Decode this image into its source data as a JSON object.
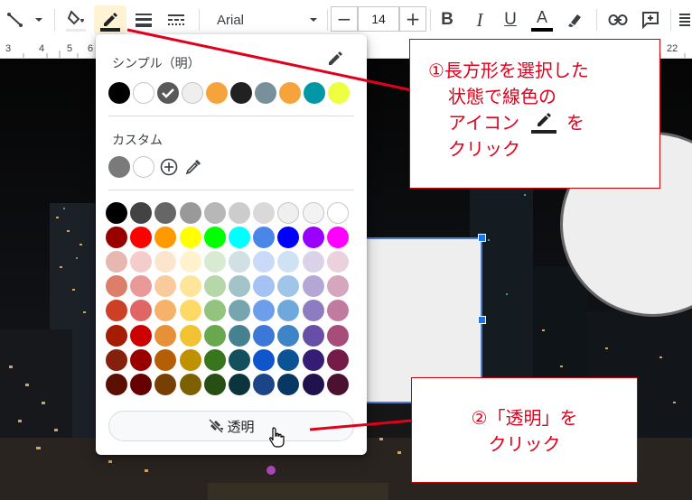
{
  "toolbar": {
    "font_name": "Arial",
    "font_size": "14",
    "minus": "−",
    "plus": "+",
    "bold": "B",
    "italic": "I",
    "underline": "U",
    "text_color": "A",
    "text_color_bar": "#000000",
    "fill_color_bar": "#e8eaed",
    "border_color_bar": "#202124",
    "highlight_color": "#fff3d6"
  },
  "ruler": {
    "marks": [
      "3",
      "4",
      "5",
      "6",
      "22"
    ]
  },
  "palette": {
    "simple_label": "シンプル（明）",
    "custom_label": "カスタム",
    "simple_colors": [
      "#000000",
      "#ffffff",
      "#595959",
      "#eeeeee",
      "#f6a33b",
      "#212121",
      "#78909c",
      "#f6a33b",
      "#0097a7",
      "#eeff41"
    ],
    "selected_index": 2,
    "custom_colors": [
      "#7a7a7a",
      "#ffffff"
    ],
    "grid": [
      [
        "#000000",
        "#434343",
        "#666666",
        "#999999",
        "#b7b7b7",
        "#cccccc",
        "#d9d9d9",
        "#efefef",
        "#f3f3f3",
        "#ffffff"
      ],
      [
        "#980000",
        "#ff0000",
        "#ff9900",
        "#ffff00",
        "#00ff00",
        "#00ffff",
        "#4a86e8",
        "#0000ff",
        "#9900ff",
        "#ff00ff"
      ],
      [
        "#e6b8af",
        "#f4cccc",
        "#fce5cd",
        "#fff2cc",
        "#d9ead3",
        "#d0e0e3",
        "#c9daf8",
        "#cfe2f3",
        "#d9d2e9",
        "#ead1dc"
      ],
      [
        "#dd7e6b",
        "#ea9999",
        "#f9cb9c",
        "#ffe599",
        "#b6d7a8",
        "#a2c4c9",
        "#a4c2f4",
        "#9fc5e8",
        "#b4a7d6",
        "#d5a6bd"
      ],
      [
        "#cc4125",
        "#e06666",
        "#f6b26b",
        "#ffd966",
        "#93c47d",
        "#76a5af",
        "#6d9eeb",
        "#6fa8dc",
        "#8e7cc3",
        "#c27ba0"
      ],
      [
        "#a61c00",
        "#cc0000",
        "#e69138",
        "#f1c232",
        "#6aa84f",
        "#45818e",
        "#3c78d8",
        "#3d85c6",
        "#674ea7",
        "#a64d79"
      ],
      [
        "#85200c",
        "#990000",
        "#b45f06",
        "#bf9000",
        "#38761d",
        "#134f5c",
        "#1155cc",
        "#0b5394",
        "#351c75",
        "#741b47"
      ],
      [
        "#5b0f00",
        "#660000",
        "#783f04",
        "#7f6000",
        "#274e13",
        "#0c343d",
        "#1c4587",
        "#073763",
        "#20124d",
        "#4c1130"
      ]
    ],
    "transparent_label": "透明"
  },
  "callouts": {
    "step1": [
      "①長方形を選択した",
      "状態で線色の",
      "アイコン",
      "を",
      "クリック"
    ],
    "step2": [
      "②「透明」を",
      "クリック"
    ],
    "border": "#cc0000",
    "text": "#e0001b",
    "arrow": "#e0001b"
  },
  "canvas": {
    "background": "#070707",
    "rect_fill": "#eeeeee",
    "rect_border": "#4a7bd0",
    "circle_fill": "#eeeeee",
    "circle_border": "#666666"
  }
}
